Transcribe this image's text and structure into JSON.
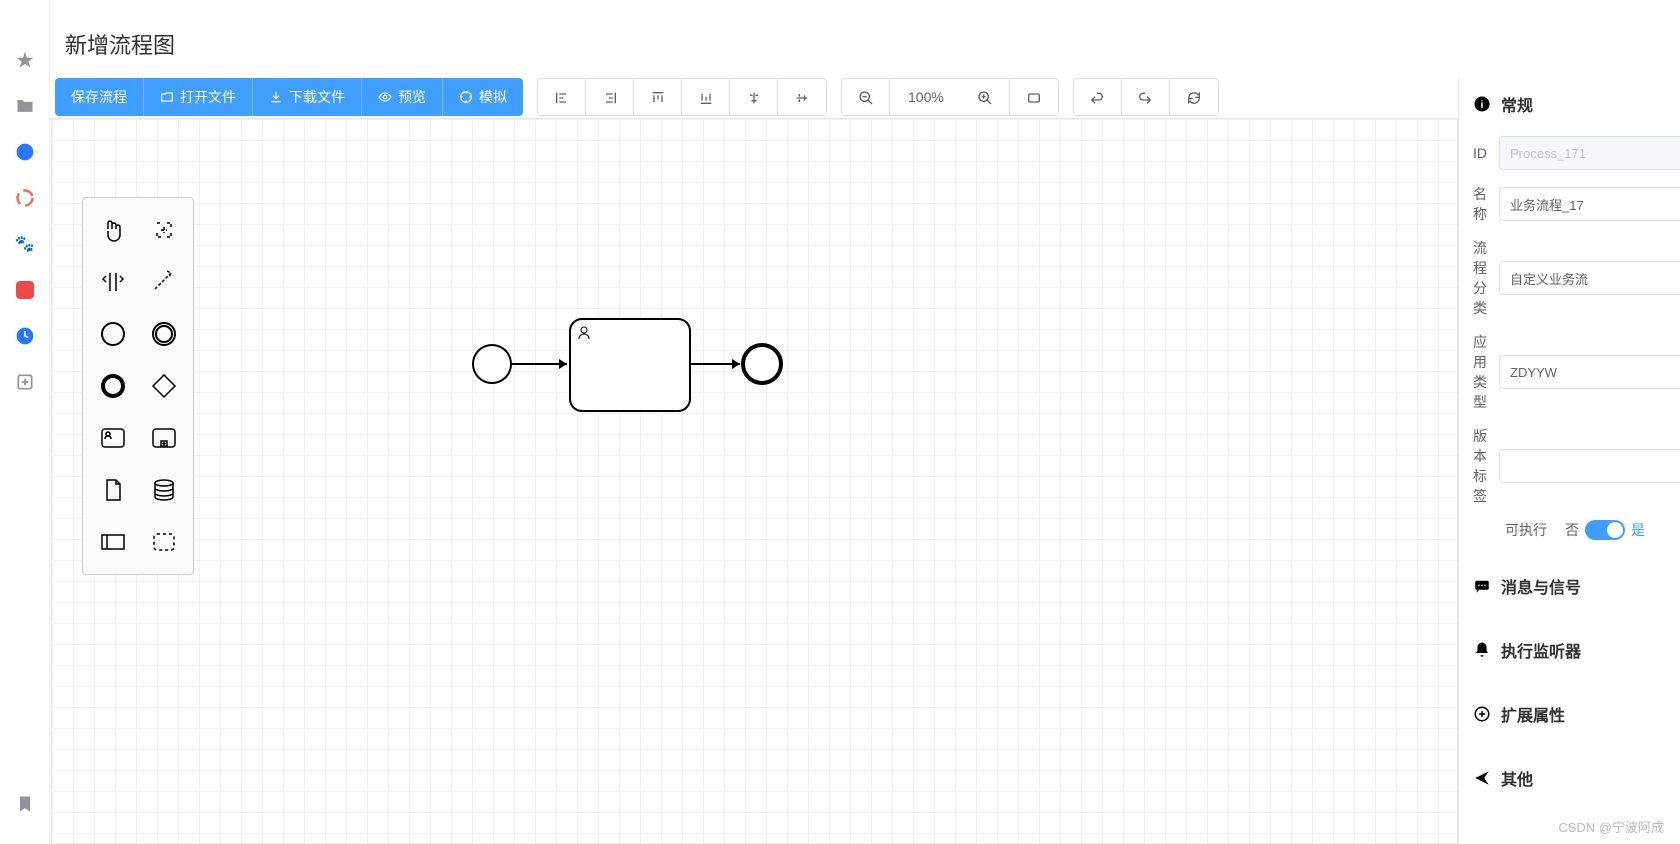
{
  "page": {
    "title": "新增流程图"
  },
  "toolbar": {
    "save": "保存流程",
    "open": "打开文件",
    "download": "下载文件",
    "preview": "预览",
    "simulate": "模拟",
    "zoom": "100%"
  },
  "panel": {
    "sections": {
      "general": "常规",
      "message": "消息与信号",
      "listener": "执行监听器",
      "extension": "扩展属性",
      "other": "其他"
    },
    "fields": {
      "id": {
        "label": "ID",
        "value": "Process_171"
      },
      "name": {
        "label": "名称",
        "value": "业务流程_17"
      },
      "category": {
        "label": "流程分类",
        "value": "自定义业务流"
      },
      "appType": {
        "label": "应用类型",
        "value": "ZDYYW"
      },
      "versionTag": {
        "label": "版本标签",
        "value": ""
      },
      "executable": {
        "label": "可执行",
        "no": "否",
        "yes": "是"
      }
    }
  },
  "watermark": "CSDN @宁波阿成"
}
